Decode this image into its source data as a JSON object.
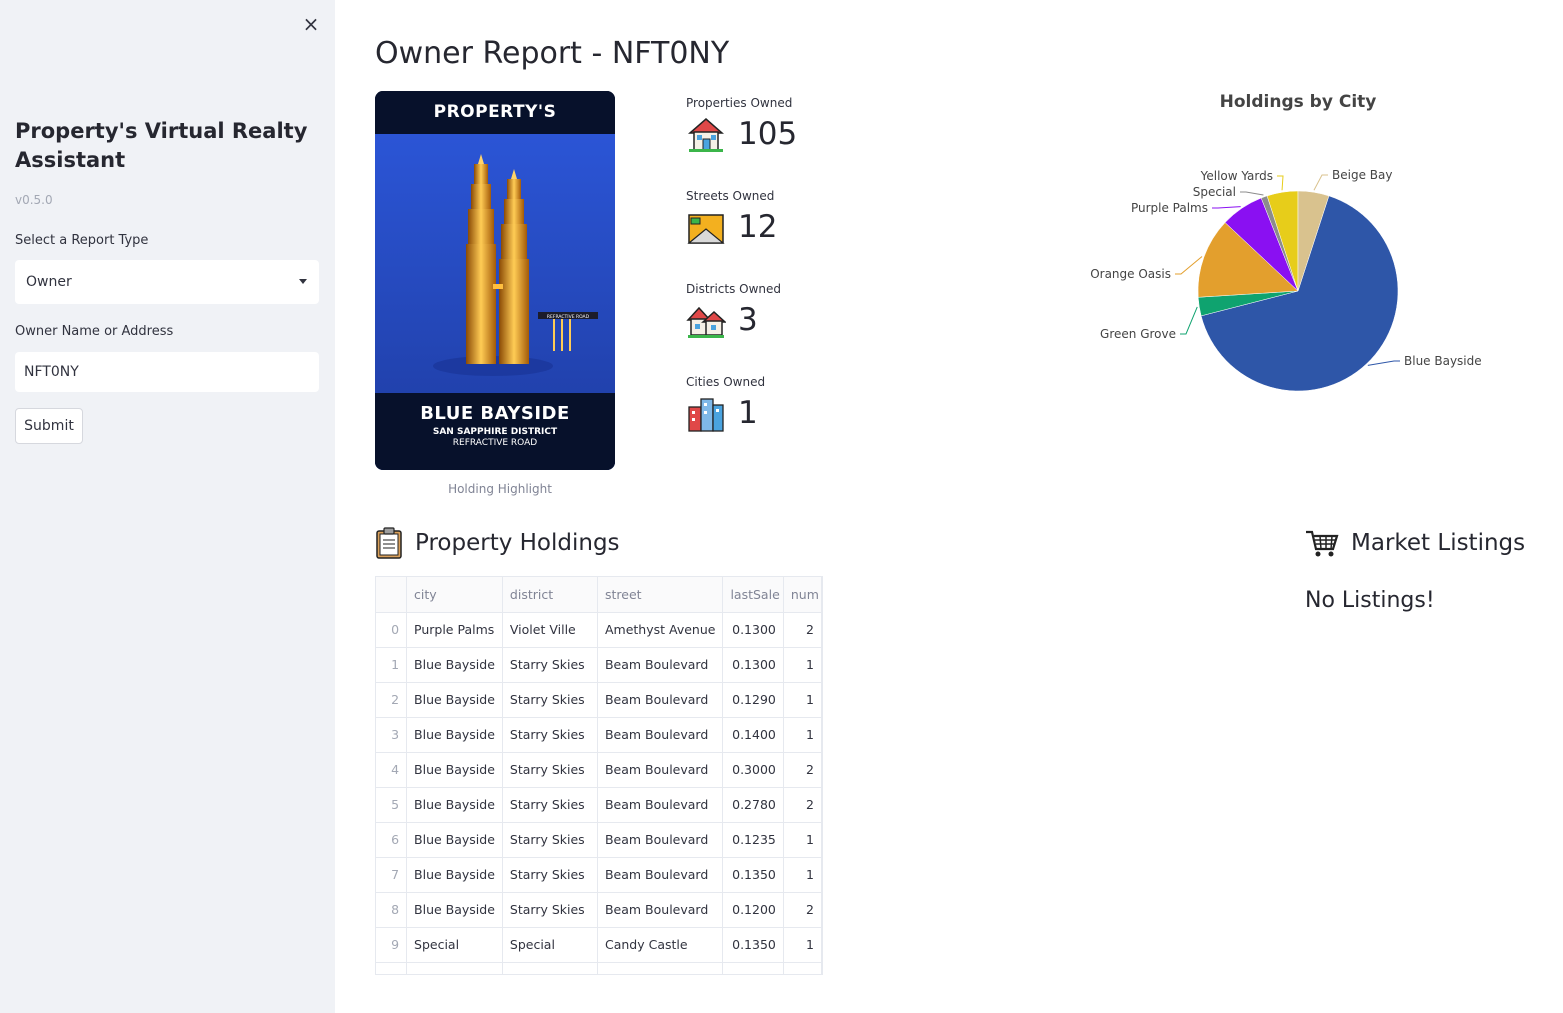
{
  "sidebar": {
    "close_icon": "×",
    "title": "Property's Virtual Realty Assistant",
    "version": "v0.5.0",
    "report_type_label": "Select a Report Type",
    "report_type_value": "Owner",
    "owner_label": "Owner Name or Address",
    "owner_value": "NFT0NY",
    "submit_label": "Submit"
  },
  "main": {
    "title": "Owner Report - NFT0NY",
    "card": {
      "brand": "PROPERTY'S",
      "name": "BLUE BAYSIDE",
      "district": "SAN SAPPHIRE DISTRICT",
      "street": "REFRACTIVE ROAD",
      "sign": "REFRACTIVE ROAD",
      "caption": "Holding Highlight"
    },
    "metrics": [
      {
        "label": "Properties Owned",
        "value": "105",
        "icon": "house-icon"
      },
      {
        "label": "Streets Owned",
        "value": "12",
        "icon": "street-icon"
      },
      {
        "label": "Districts Owned",
        "value": "3",
        "icon": "houses-icon"
      },
      {
        "label": "Cities Owned",
        "value": "1",
        "icon": "city-icon"
      }
    ],
    "holdings_title": "Property Holdings",
    "market_title": "Market Listings",
    "no_listings": "No Listings!"
  },
  "table": {
    "columns": [
      "",
      "city",
      "district",
      "street",
      "lastSale",
      "num"
    ],
    "rows": [
      [
        "0",
        "Purple Palms",
        "Violet Ville",
        "Amethyst Avenue",
        "0.1300",
        "2"
      ],
      [
        "1",
        "Blue Bayside",
        "Starry Skies",
        "Beam Boulevard",
        "0.1300",
        "1"
      ],
      [
        "2",
        "Blue Bayside",
        "Starry Skies",
        "Beam Boulevard",
        "0.1290",
        "1"
      ],
      [
        "3",
        "Blue Bayside",
        "Starry Skies",
        "Beam Boulevard",
        "0.1400",
        "1"
      ],
      [
        "4",
        "Blue Bayside",
        "Starry Skies",
        "Beam Boulevard",
        "0.3000",
        "2"
      ],
      [
        "5",
        "Blue Bayside",
        "Starry Skies",
        "Beam Boulevard",
        "0.2780",
        "2"
      ],
      [
        "6",
        "Blue Bayside",
        "Starry Skies",
        "Beam Boulevard",
        "0.1235",
        "1"
      ],
      [
        "7",
        "Blue Bayside",
        "Starry Skies",
        "Beam Boulevard",
        "0.1350",
        "1"
      ],
      [
        "8",
        "Blue Bayside",
        "Starry Skies",
        "Beam Boulevard",
        "0.1200",
        "2"
      ],
      [
        "9",
        "Special",
        "Special",
        "Candy Castle",
        "0.1350",
        "1"
      ]
    ]
  },
  "chart_data": {
    "type": "pie",
    "title": "Holdings by City",
    "slices": [
      {
        "name": "Blue Bayside",
        "value": 66,
        "color": "#2e56a8"
      },
      {
        "name": "Green Grove",
        "value": 3,
        "color": "#0fa36f"
      },
      {
        "name": "Orange Oasis",
        "value": 13,
        "color": "#e39f2d"
      },
      {
        "name": "Purple Palms",
        "value": 7,
        "color": "#8a10f2"
      },
      {
        "name": "Special",
        "value": 1,
        "color": "#8c8c8c"
      },
      {
        "name": "Yellow Yards",
        "value": 5,
        "color": "#e7cd1a"
      },
      {
        "name": "Beige Bay",
        "value": 5,
        "color": "#d9c28e"
      }
    ]
  }
}
